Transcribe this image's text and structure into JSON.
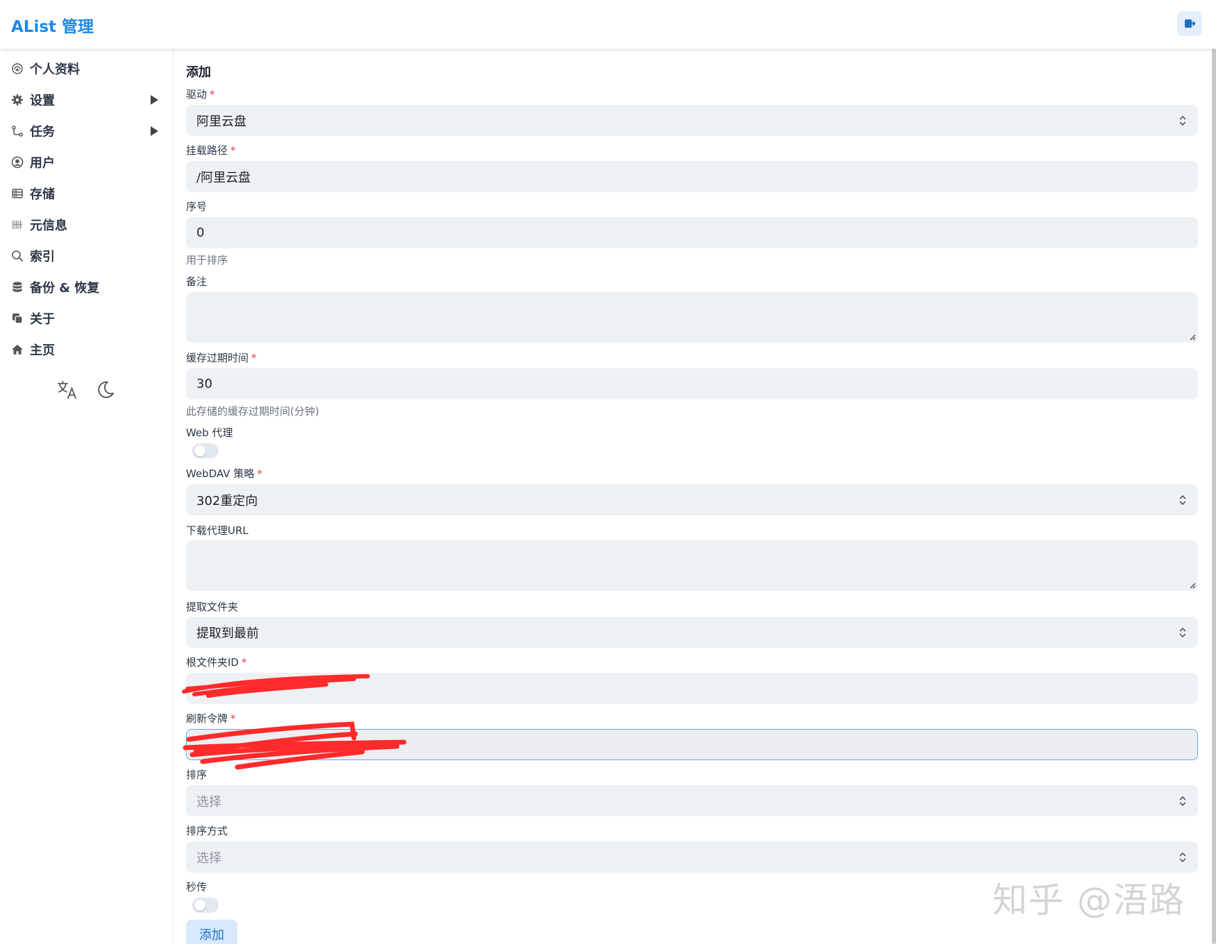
{
  "header": {
    "brand": "AList 管理"
  },
  "sidebar": {
    "items": [
      {
        "label": "个人资料",
        "icon": "fingerprint-icon"
      },
      {
        "label": "设置",
        "icon": "gear-icon",
        "expandable": true
      },
      {
        "label": "任务",
        "icon": "git-branch-icon",
        "expandable": true
      },
      {
        "label": "用户",
        "icon": "user-circle-icon"
      },
      {
        "label": "存储",
        "icon": "storage-icon"
      },
      {
        "label": "元信息",
        "icon": "meta-grid-icon"
      },
      {
        "label": "索引",
        "icon": "search-icon"
      },
      {
        "label": "备份 & 恢复",
        "icon": "database-icon"
      },
      {
        "label": "关于",
        "icon": "copy-icon"
      },
      {
        "label": "主页",
        "icon": "home-icon"
      }
    ],
    "tools": [
      "translate-icon",
      "moon-icon"
    ]
  },
  "form": {
    "title": "添加",
    "driver": {
      "label": "驱动",
      "required": "*",
      "value": "阿里云盘"
    },
    "mount_path": {
      "label": "挂载路径",
      "required": "*",
      "value": "/阿里云盘"
    },
    "order": {
      "label": "序号",
      "value": "0",
      "hint": "用于排序"
    },
    "remark": {
      "label": "备注",
      "value": ""
    },
    "cache_expiration": {
      "label": "缓存过期时间",
      "required": "*",
      "value": "30",
      "hint": "此存储的缓存过期时间(分钟)"
    },
    "web_proxy": {
      "label": "Web 代理",
      "enabled": false
    },
    "webdav_policy": {
      "label": "WebDAV 策略",
      "required": "*",
      "value": "302重定向"
    },
    "down_proxy_url": {
      "label": "下载代理URL",
      "value": ""
    },
    "extract_folder": {
      "label": "提取文件夹",
      "value": "提取到最前"
    },
    "root_folder_id": {
      "label": "根文件夹ID",
      "required": "*"
    },
    "refresh_token": {
      "label": "刷新令牌",
      "required": "*"
    },
    "order_by": {
      "label": "排序",
      "placeholder": "选择"
    },
    "order_direction": {
      "label": "排序方式",
      "placeholder": "选择"
    },
    "rapid_upload": {
      "label": "秒传",
      "enabled": false
    },
    "submit_label": "添加"
  },
  "watermark": "知乎 @浯路",
  "colors": {
    "brand": "#1e88e5",
    "required": "#e53e3e",
    "field_bg": "#eef1f4",
    "redaction": "#ff2a2a"
  }
}
